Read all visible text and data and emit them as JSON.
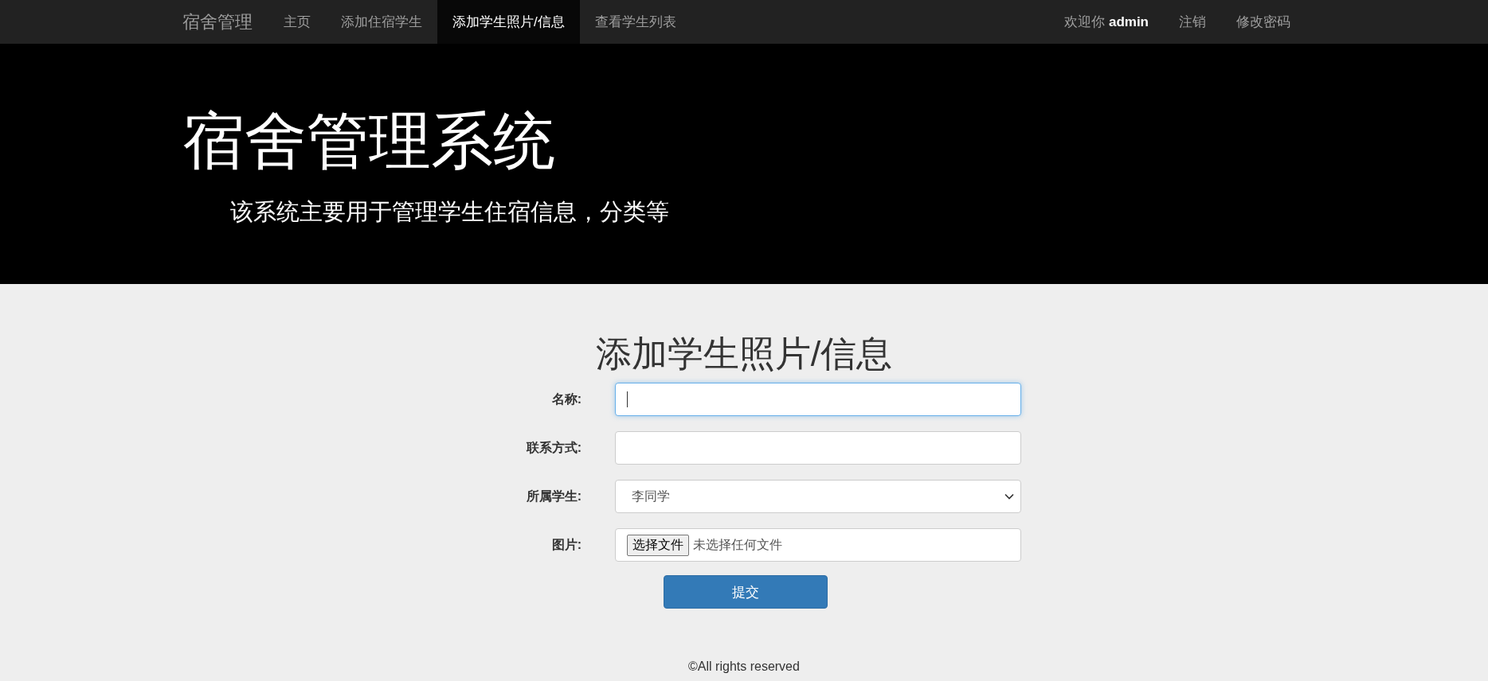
{
  "navbar": {
    "brand": "宿舍管理",
    "items": [
      {
        "label": "主页",
        "selected": false
      },
      {
        "label": "添加住宿学生",
        "selected": false
      },
      {
        "label": "添加学生照片/信息",
        "selected": true
      },
      {
        "label": "查看学生列表",
        "selected": false
      }
    ],
    "welcome": "欢迎你",
    "user": "admin",
    "links": [
      "注销",
      "修改密码"
    ]
  },
  "hero": {
    "title": "宿舍管理系统",
    "subtitle": "该系统主要用于管理学生住宿信息，分类等"
  },
  "form": {
    "title": "添加学生照片/信息",
    "fields": [
      {
        "kind": "text",
        "label": "名称:",
        "focused": true
      },
      {
        "kind": "text",
        "label": "联系方式:",
        "focused": false
      },
      {
        "kind": "select",
        "label": "所属学生:",
        "value": "李同学",
        "focused": false
      },
      {
        "kind": "file",
        "label": "图片:",
        "button": "选择文件",
        "status": "未选择任何文件",
        "focused": false
      }
    ],
    "submit": "提交"
  },
  "footer": "©All rights reserved"
}
